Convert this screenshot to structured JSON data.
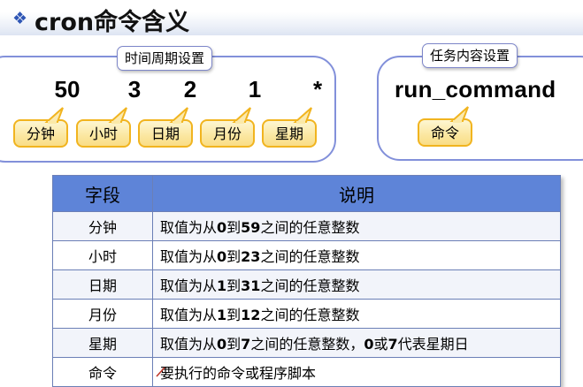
{
  "title": "cron命令含义",
  "title_bullet": "❖",
  "left_panel": {
    "caption": "时间周期设置",
    "values": [
      "50",
      "3",
      "2",
      "1",
      "*"
    ],
    "labels": [
      "分钟",
      "小时",
      "日期",
      "月份",
      "星期"
    ]
  },
  "right_panel": {
    "caption": "任务内容设置",
    "command": "run_command",
    "label": "命令"
  },
  "table": {
    "headers": [
      "字段",
      "说明"
    ],
    "rows": [
      {
        "field": "分钟",
        "desc": [
          "取值为从",
          "0",
          "到",
          "59",
          "之间的任意整数"
        ]
      },
      {
        "field": "小时",
        "desc": [
          "取值为从",
          "0",
          "到",
          "23",
          "之间的任意整数"
        ]
      },
      {
        "field": "日期",
        "desc": [
          "取值为从",
          "1",
          "到",
          "31",
          "之间的任意整数"
        ]
      },
      {
        "field": "月份",
        "desc": [
          "取值为从",
          "1",
          "到",
          "12",
          "之间的任意整数"
        ]
      },
      {
        "field": "星期",
        "desc": [
          "取值为从",
          "0",
          "到",
          "7",
          "之间的任意整数，",
          "0",
          "或",
          "7",
          "代表星期日"
        ]
      },
      {
        "field": "命令",
        "desc": [
          "要执行的命令或程序脚本"
        ]
      }
    ]
  },
  "colors": {
    "accent": "#2f56b5",
    "panel_border": "#8290da",
    "callout_fill": "#fbe7a0",
    "callout_border": "#f1b41f",
    "table_header": "#5e84d8"
  }
}
